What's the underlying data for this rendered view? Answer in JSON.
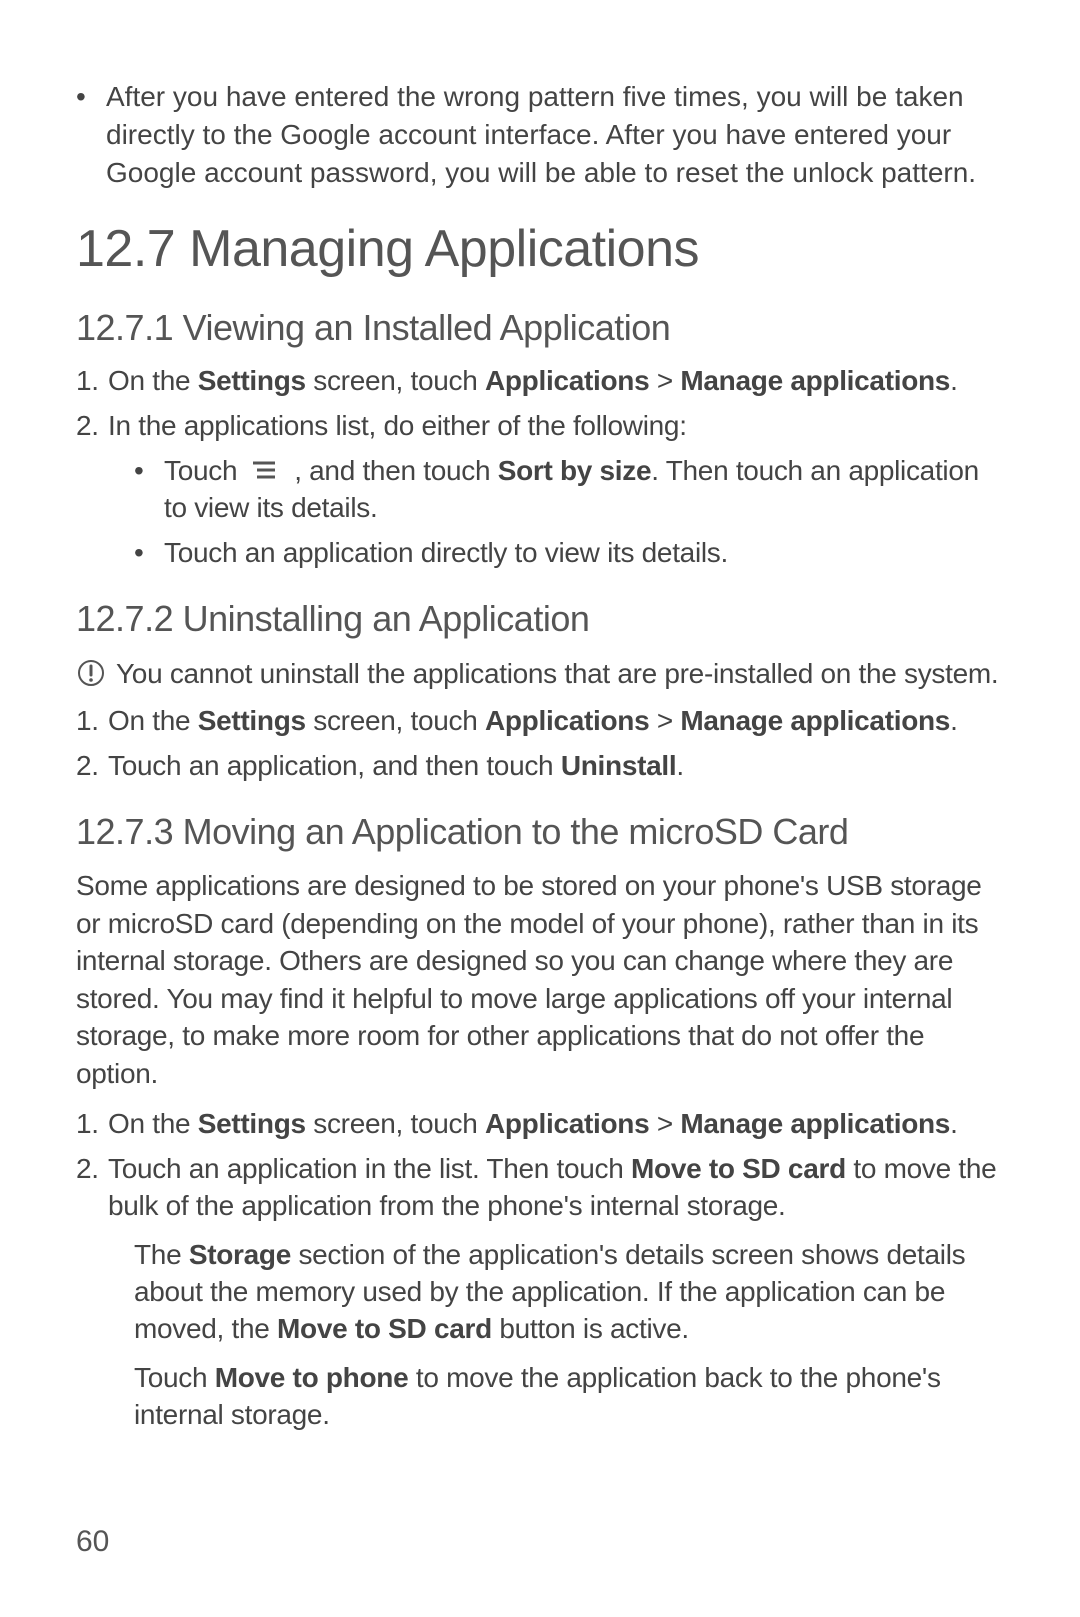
{
  "top_bullet": "After you have entered the wrong pattern five times, you will be taken directly to the Google account interface. After you have entered your Google account password, you will be able to reset the unlock pattern.",
  "section_heading": "12.7  Managing Applications",
  "subs": {
    "viewing": {
      "heading": "12.7.1  Viewing an Installed Application",
      "step1_pre": "On the ",
      "step1_bold1": "Settings",
      "step1_mid": " screen, touch ",
      "step1_bold2": "Applications",
      "step1_gt": " > ",
      "step1_bold3": "Manage applications",
      "step1_end": ".",
      "step2": "In the applications list, do either of the following:",
      "nested1_pre": "Touch ",
      "nested1_mid": " , and then touch ",
      "nested1_bold": "Sort by size",
      "nested1_post": ". Then touch an application to view its details.",
      "nested2": "Touch an application directly to view its details."
    },
    "uninstalling": {
      "heading": "12.7.2  Uninstalling an Application",
      "note": "You cannot uninstall the applications that are pre-installed on the system.",
      "step1_pre": "On the ",
      "step1_bold1": "Settings",
      "step1_mid": " screen, touch ",
      "step1_bold2": "Applications",
      "step1_gt": " > ",
      "step1_bold3": "Manage applications",
      "step1_end": ".",
      "step2_pre": "Touch an application, and then touch ",
      "step2_bold": "Uninstall",
      "step2_end": "."
    },
    "moving": {
      "heading": "12.7.3  Moving an Application to the microSD Card",
      "intro": "Some applications are designed to be stored on your phone's USB storage or microSD card (depending on the model of your phone), rather than in its internal storage. Others are designed so you can change where they are stored. You may find it helpful to move large applications off your internal storage, to make more room for other applications that do not offer the option.",
      "step1_pre": "On the ",
      "step1_bold1": "Settings",
      "step1_mid": " screen, touch ",
      "step1_bold2": "Applications",
      "step1_gt": " > ",
      "step1_bold3": "Manage applications",
      "step1_end": ".",
      "step2_pre": "Touch an application in the list. Then touch ",
      "step2_bold": "Move to SD card",
      "step2_post": " to move the bulk of the application from the phone's internal storage.",
      "indent1_pre": "The ",
      "indent1_bold1": "Storage",
      "indent1_mid": " section of the application's details screen shows details about the memory used by the application. If the application can be moved, the ",
      "indent1_bold2": "Move to SD card",
      "indent1_post": " button is active.",
      "indent2_pre": "Touch ",
      "indent2_bold": "Move to phone",
      "indent2_post": " to move the application back to the phone's internal storage."
    }
  },
  "page_number": "60"
}
